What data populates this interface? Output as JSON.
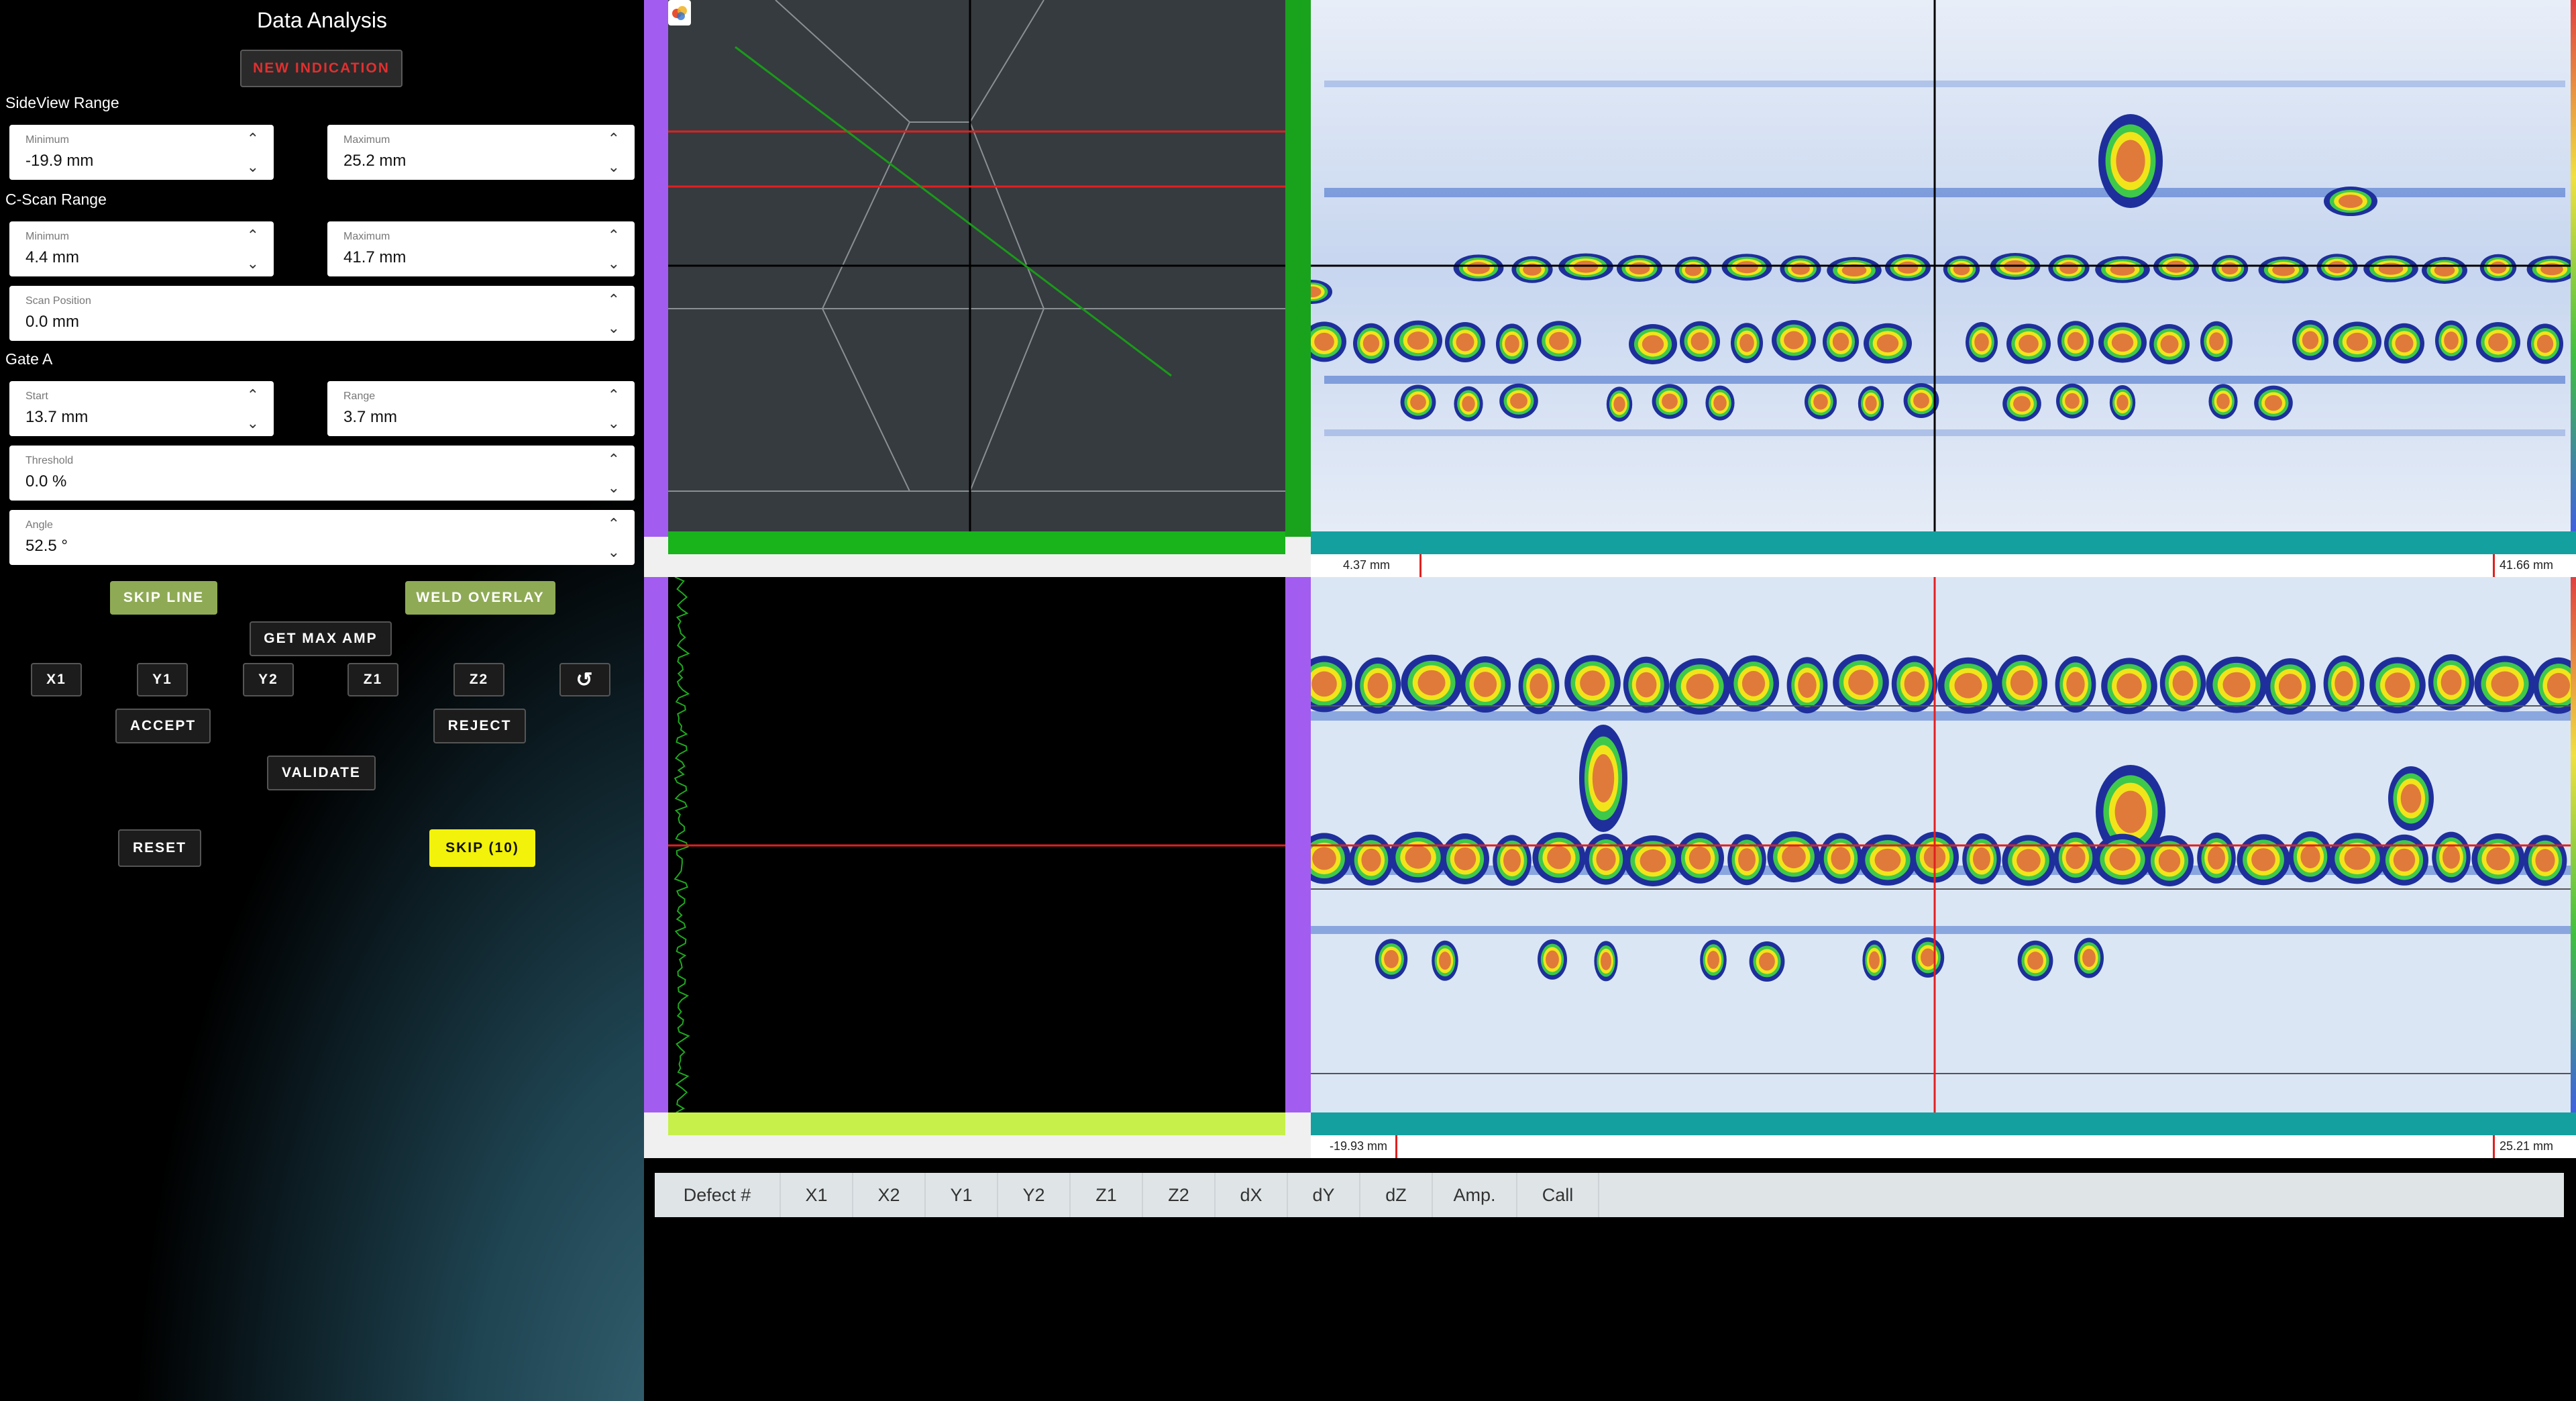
{
  "app": {
    "title": "Data Analysis",
    "new_indication": "NEW INDICATION"
  },
  "sideview": {
    "heading": "SideView Range",
    "minimum": {
      "label": "Minimum",
      "value": "-19.9 mm"
    },
    "maximum": {
      "label": "Maximum",
      "value": "25.2 mm"
    }
  },
  "cscan": {
    "heading": "C-Scan Range",
    "minimum": {
      "label": "Minimum",
      "value": "4.4 mm"
    },
    "maximum": {
      "label": "Maximum",
      "value": "41.7 mm"
    },
    "scan_position": {
      "label": "Scan Position",
      "value": "0.0 mm"
    }
  },
  "gate": {
    "heading": "Gate A",
    "start": {
      "label": "Start",
      "value": "13.7 mm"
    },
    "range": {
      "label": "Range",
      "value": "3.7 mm"
    },
    "threshold": {
      "label": "Threshold",
      "value": "0.0 %"
    },
    "angle": {
      "label": "Angle",
      "value": "52.5 °"
    }
  },
  "buttons": {
    "skip_line": "SKIP LINE",
    "weld_overlay": "WELD OVERLAY",
    "get_max_amp": "GET MAX AMP",
    "x1": "X1",
    "y1": "Y1",
    "y2": "Y2",
    "z1": "Z1",
    "z2": "Z2",
    "accept": "ACCEPT",
    "reject": "REJECT",
    "validate": "VALIDATE",
    "reset": "RESET",
    "skip": "SKIP (10)"
  },
  "cscan_view": {
    "left_pos": "4.37 mm",
    "right_pos": "41.66 mm"
  },
  "sideview_view": {
    "left_pos": "-19.93 mm",
    "right_pos": "25.21 mm"
  },
  "table": {
    "headers": [
      "Defect #",
      "X1",
      "X2",
      "Y1",
      "Y2",
      "Z1",
      "Z2",
      "dX",
      "dY",
      "dZ",
      "Amp.",
      "Call"
    ]
  },
  "colors": {
    "accent_red": "#e03030",
    "olive": "#8faa55",
    "yellow": "#f2f20a",
    "ruler_purple": "#a25df0",
    "ruler_green": "#19a31c",
    "ruler_teal": "#15a0a0"
  },
  "icons": {
    "undo": "undo-icon",
    "app_logo": "app-logo-icon"
  }
}
